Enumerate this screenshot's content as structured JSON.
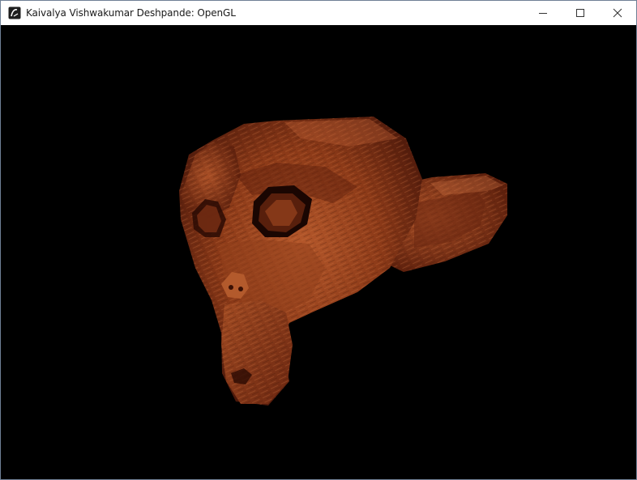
{
  "window": {
    "title": "Kaivalya Vishwakumar Deshpande: OpenGL",
    "icon": "opengl-app-icon",
    "controls": [
      "minimize-icon",
      "maximize-icon",
      "close-icon"
    ]
  },
  "viewport": {
    "background": "#000000",
    "model": "monkey-head",
    "texture_colors": [
      "#7a2f14",
      "#a64a22",
      "#c7693a",
      "#4a160a"
    ]
  }
}
